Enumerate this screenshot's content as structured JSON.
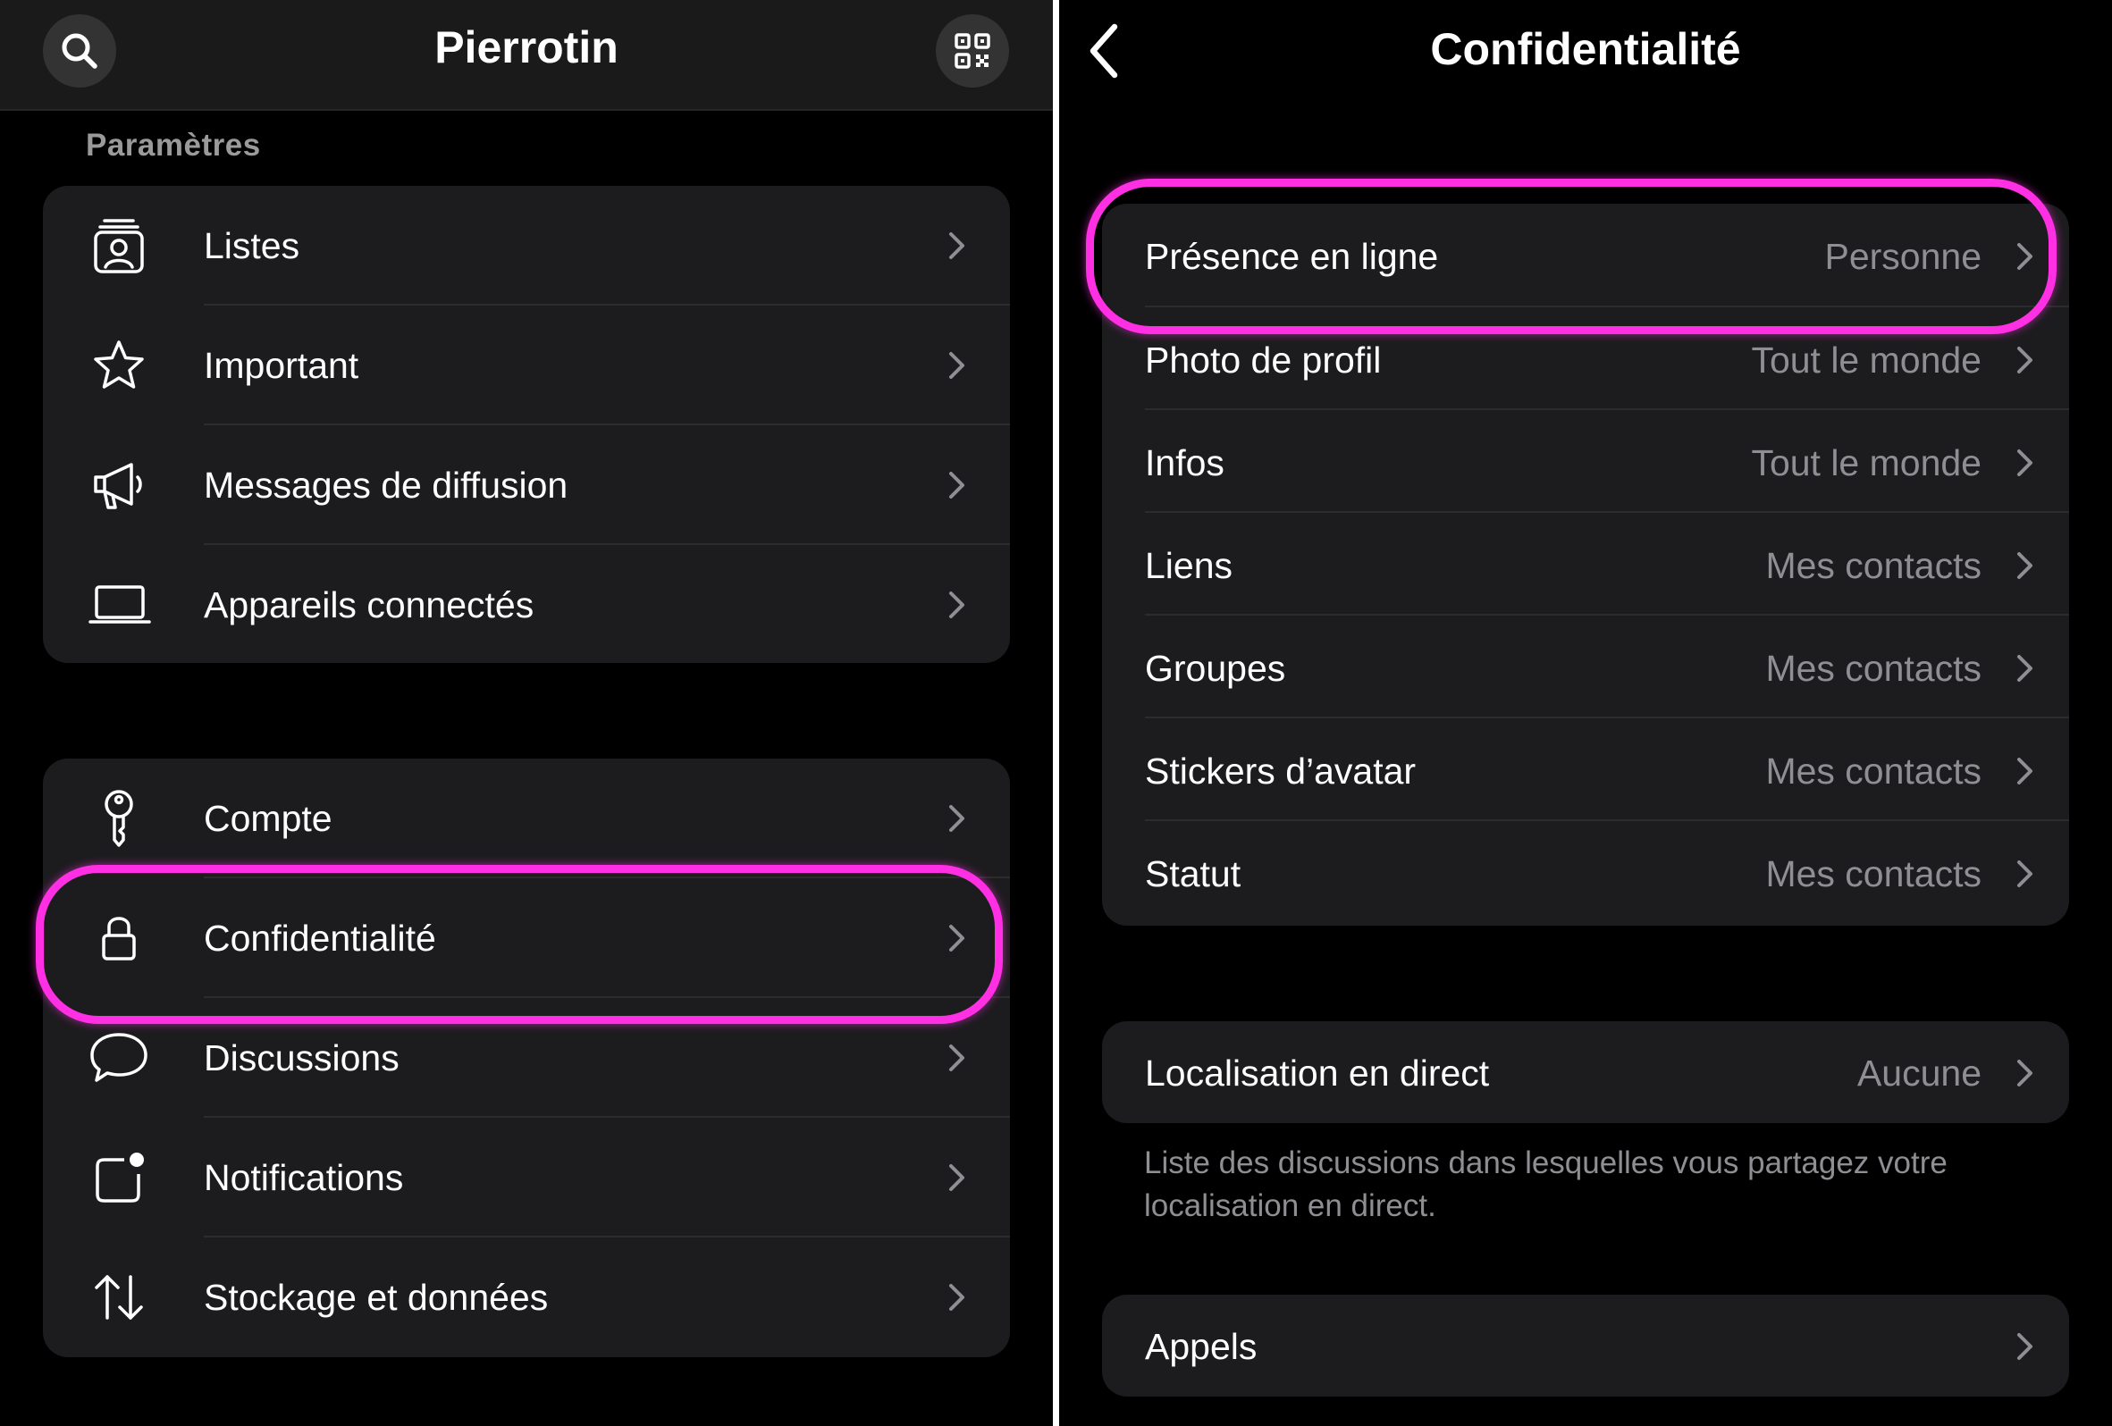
{
  "left": {
    "header": {
      "title": "Pierrotin",
      "search_icon": "search-icon",
      "qr_icon": "qr-code-icon"
    },
    "section_label": "Paramètres",
    "group1": [
      {
        "label": "Listes",
        "icon": "contact-lists-icon"
      },
      {
        "label": "Important",
        "icon": "star-icon"
      },
      {
        "label": "Messages de diffusion",
        "icon": "megaphone-icon"
      },
      {
        "label": "Appareils connectés",
        "icon": "laptop-icon"
      }
    ],
    "group2": [
      {
        "label": "Compte",
        "icon": "key-icon"
      },
      {
        "label": "Confidentialité",
        "icon": "lock-icon",
        "highlighted": true
      },
      {
        "label": "Discussions",
        "icon": "chat-bubble-icon"
      },
      {
        "label": "Notifications",
        "icon": "notification-badge-icon"
      },
      {
        "label": "Stockage et données",
        "icon": "up-down-arrows-icon"
      }
    ]
  },
  "right": {
    "header": {
      "title": "Confidentialité",
      "back_icon": "chevron-left-icon"
    },
    "group1": [
      {
        "label": "Présence en ligne",
        "value": "Personne",
        "highlighted": true
      },
      {
        "label": "Photo de profil",
        "value": "Tout le monde"
      },
      {
        "label": "Infos",
        "value": "Tout le monde"
      },
      {
        "label": "Liens",
        "value": "Mes contacts"
      },
      {
        "label": "Groupes",
        "value": "Mes contacts"
      },
      {
        "label": "Stickers d’avatar",
        "value": "Mes contacts"
      },
      {
        "label": "Statut",
        "value": "Mes contacts"
      }
    ],
    "live_location": {
      "label": "Localisation en direct",
      "value": "Aucune"
    },
    "live_location_note": "Liste des discussions dans lesquelles vous partagez votre localisation en direct.",
    "calls": {
      "label": "Appels"
    }
  },
  "colors": {
    "highlight": "#ff2fe4",
    "background": "#000000",
    "cell": "#1c1c1e",
    "secondary_text": "#8e8e93"
  }
}
